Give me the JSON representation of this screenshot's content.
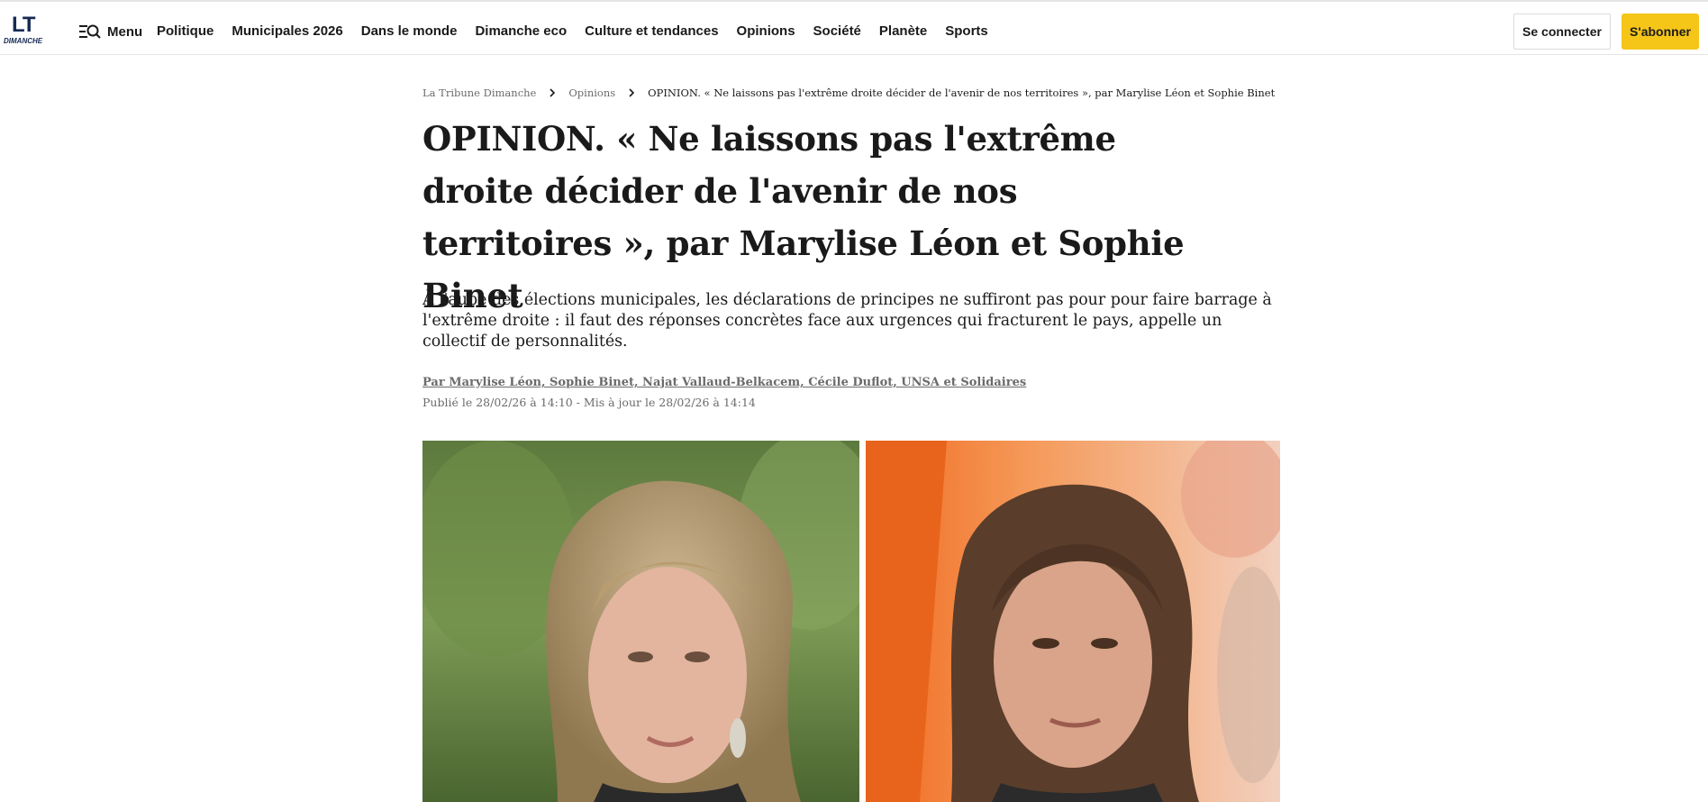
{
  "header": {
    "logo": {
      "main": "LT",
      "sub": "DIMANCHE",
      "icon": "lt-dimanche-logo"
    },
    "menu_label": "Menu",
    "menu_icon": "menu-search-icon",
    "nav": [
      "Politique",
      "Municipales 2026",
      "Dans le monde",
      "Dimanche eco",
      "Culture et tendances",
      "Opinions",
      "Société",
      "Planète",
      "Sports"
    ],
    "login_label": "Se connecter",
    "subscribe_label": "S'abonner",
    "subscribe_color": "#f5c518"
  },
  "breadcrumb": {
    "items": [
      "La Tribune Dimanche",
      "Opinions"
    ],
    "current": "OPINION. « Ne laissons pas l'extrême droite décider de l'avenir de nos territoires », par Marylise Léon et Sophie Binet",
    "separator_icon": "chevron-right-icon"
  },
  "article": {
    "title": "OPINION. « Ne laissons pas l'extrême droite décider de l'avenir de nos territoires », par Marylise Léon et Sophie Binet",
    "lead": "À l'aube des élections municipales, les déclarations de principes ne suffiront pas pour pour faire barrage à l'extrême droite : il faut des réponses concrètes face aux urgences qui fracturent le pays, appelle un collectif de personnalités.",
    "byline": "Par Marylise Léon, Sophie Binet, Najat Vallaud-Belkacem, Cécile Duflot, UNSA et Solidaires",
    "dates": "Publié le 28/02/26 à 14:10 - Mis à jour le 28/02/26 à 14:14",
    "photos": [
      "portrait-left",
      "portrait-right"
    ]
  }
}
